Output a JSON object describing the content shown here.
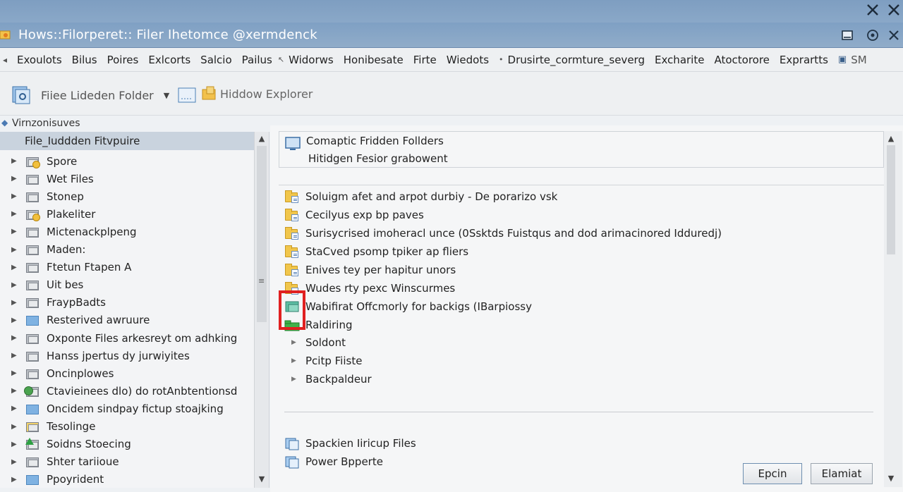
{
  "window": {
    "title": "Hows::Filorperet:: Filer Ihetomce @xermdenck"
  },
  "menubar": {
    "items": [
      {
        "label": "Exoulots",
        "glyph": ""
      },
      {
        "label": "Bilus",
        "glyph": ""
      },
      {
        "label": "Poires",
        "glyph": ""
      },
      {
        "label": "Exlcorts",
        "glyph": ""
      },
      {
        "label": "Salcio",
        "glyph": ""
      },
      {
        "label": "Pailus",
        "glyph": ""
      },
      {
        "label": "Widorws",
        "glyph": "↖"
      },
      {
        "label": "Honibesate",
        "glyph": ""
      },
      {
        "label": "Firte",
        "glyph": ""
      },
      {
        "label": "Wiedots",
        "glyph": ""
      },
      {
        "label": "Drusirte_cormture_severg",
        "glyph": "•"
      },
      {
        "label": "Excharite",
        "glyph": ""
      },
      {
        "label": "Atoctorore",
        "glyph": ""
      },
      {
        "label": "Exprartts",
        "glyph": ""
      },
      {
        "label": "SM",
        "glyph": "▣"
      }
    ]
  },
  "toolbar": {
    "folder_label": "Fiiee Lideden Folder",
    "explorer_label": "Hiddow Explorer"
  },
  "nav": {
    "heading": "Virnzonisuves",
    "selected": "File_Iuddden Fitvpuire",
    "items": [
      {
        "label": "Spore",
        "icon": "badge-folder-icon"
      },
      {
        "label": "Wet Files",
        "icon": "grey-folder-icon"
      },
      {
        "label": "Stonep",
        "icon": "grey-folder-icon"
      },
      {
        "label": "Plakeliter",
        "icon": "badge-folder-icon"
      },
      {
        "label": "Mictenackplpeng",
        "icon": "grey-folder-icon"
      },
      {
        "label": "Maden:",
        "icon": "grey-folder-icon"
      },
      {
        "label": "Ftetun Ftapen  A",
        "icon": "grey-folder-icon"
      },
      {
        "label": "Uit bes",
        "icon": "grey-folder-icon"
      },
      {
        "label": "FraypBadts",
        "icon": "grey-folder-icon"
      },
      {
        "label": "Resterived awruure",
        "icon": "blue-folder-icon"
      },
      {
        "label": "Oxponte Files arkesreyt om adhking",
        "icon": "grey-folder-icon"
      },
      {
        "label": "Hanss jpertus dy jurwiyites",
        "icon": "grey-folder-icon"
      },
      {
        "label": "Oncinplowes",
        "icon": "grey-folder-icon"
      },
      {
        "label": "Ctavieinees dlo) do rotAnbtentionsd",
        "icon": "globe-folder-icon"
      },
      {
        "label": "Oncidem sindpay fictup stoajking",
        "icon": "blue-folder-icon"
      },
      {
        "label": "Tesolinge",
        "icon": "yellow-doc-icon"
      },
      {
        "label": "Soidns Stoecing",
        "icon": "green-arrow-icon"
      },
      {
        "label": "Shter tariioue",
        "icon": "grey-folder-icon"
      },
      {
        "label": "Ppoyrident",
        "icon": "blue-folder-icon"
      }
    ]
  },
  "content": {
    "info_line1": "Comaptic Fridden Follders",
    "info_line2": "Hitidgen Fesior grabowent",
    "files": [
      {
        "label": "Soluigm afet and arpot durbiy - De porarizo vsk"
      },
      {
        "label": "Cecilyus exp bp paves"
      },
      {
        "label": "Surisycrised imoheracl unce (0Ssktds Fuistqus and dod arimacinored Idduredj)"
      },
      {
        "label": "StaCved psomp tpiker ap fliers"
      },
      {
        "label": "Enives tey per hapitur unors"
      },
      {
        "label": "Wudes rty pexc Winscurmes"
      }
    ],
    "backup_label": "Wabifirat Offcmorly for backigs (IBarpiossy",
    "raldiring_label": "Raldiring",
    "subitems": [
      "Soldont",
      "Pcitp Fiiste",
      "Backpaldeur"
    ],
    "bottom_items": [
      "Spackien Iiricup Files",
      "Power Bpperte"
    ],
    "ok_button": "Epcin",
    "cancel_button": "Elamiat"
  }
}
